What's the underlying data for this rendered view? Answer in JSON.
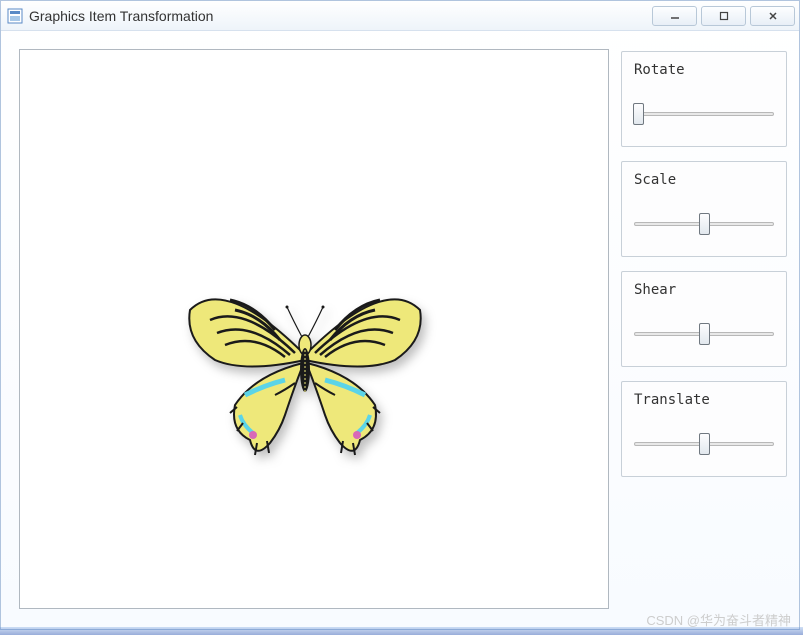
{
  "window": {
    "title": "Graphics Item Transformation"
  },
  "controls": {
    "rotate": {
      "label": "Rotate",
      "position": 3
    },
    "scale": {
      "label": "Scale",
      "position": 50
    },
    "shear": {
      "label": "Shear",
      "position": 50
    },
    "translate": {
      "label": "Translate",
      "position": 50
    }
  },
  "watermark": "CSDN @华为奋斗者精神"
}
